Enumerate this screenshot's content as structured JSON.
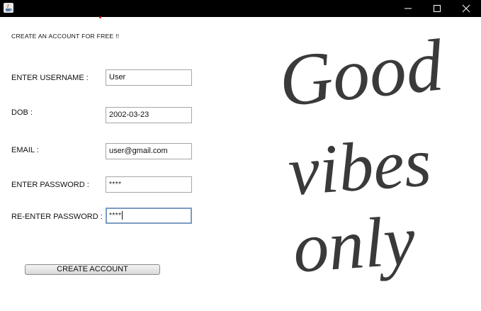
{
  "window": {
    "icon": "java-cup-icon",
    "controls": [
      "minimize-icon",
      "maximize-icon",
      "close-icon"
    ]
  },
  "form": {
    "heading": "CREATE AN ACCOUNT FOR FREE !!",
    "username_label": "ENTER USERNAME :",
    "username_value": "User",
    "dob_label": "DOB :",
    "dob_value": "2002-03-23",
    "email_label": "EMAIL :",
    "email_value": "user@gmail.com",
    "password_label": "ENTER PASSWORD :",
    "password_value": "****",
    "reenter_label": "RE-ENTER PASSWORD :",
    "reenter_value": "****",
    "submit_label": "CREATE ACCOUNT"
  },
  "artwork": {
    "line1": "Good",
    "line2": "vibes",
    "line3": "only",
    "color": "#3a3a3a"
  }
}
